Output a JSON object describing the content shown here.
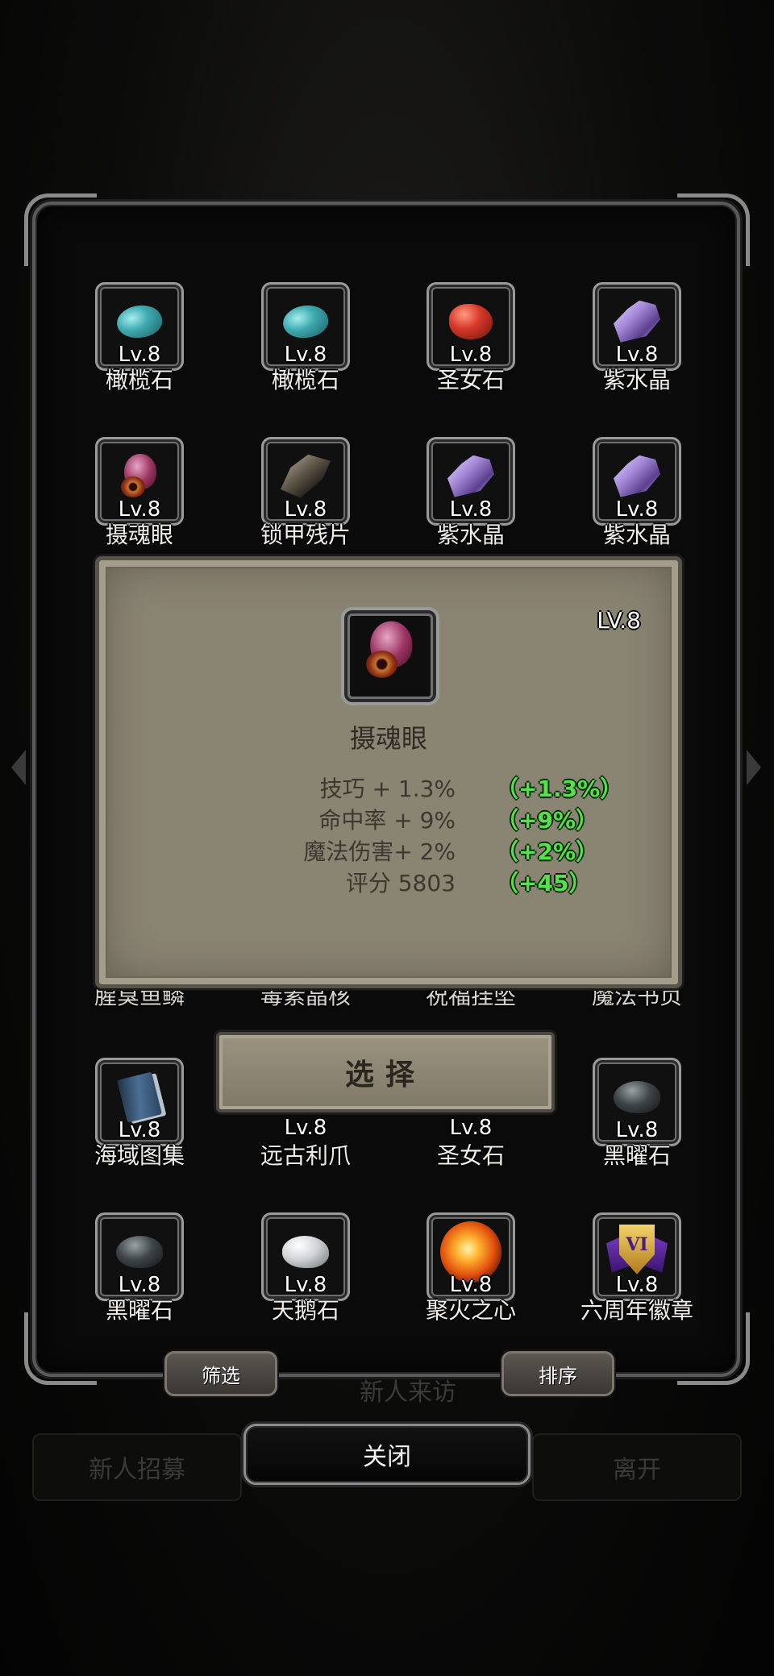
{
  "items": [
    {
      "gem": "olive",
      "level": "Lv.8",
      "name": "橄榄石"
    },
    {
      "gem": "olive",
      "level": "Lv.8",
      "name": "橄榄石"
    },
    {
      "gem": "red",
      "level": "Lv.8",
      "name": "圣女石"
    },
    {
      "gem": "amethyst",
      "level": "Lv.8",
      "name": "紫水晶"
    },
    {
      "gem": "eye",
      "level": "Lv.8",
      "name": "摄魂眼"
    },
    {
      "gem": "armor",
      "level": "Lv.8",
      "name": "锁甲残片"
    },
    {
      "gem": "amethyst",
      "level": "Lv.8",
      "name": "紫水晶"
    },
    {
      "gem": "amethyst",
      "level": "Lv.8",
      "name": "紫水晶"
    },
    {
      "gem": "hidden",
      "level": "",
      "name": "腥臭鱼鳞"
    },
    {
      "gem": "hidden",
      "level": "",
      "name": "毒素晶核"
    },
    {
      "gem": "hidden",
      "level": "",
      "name": "祝福挂坠"
    },
    {
      "gem": "hidden",
      "level": "",
      "name": "魔法书页"
    },
    {
      "gem": "book",
      "level": "Lv.8",
      "name": "海域图集"
    },
    {
      "gem": "hidden",
      "level": "Lv.8",
      "name": "远古利爪"
    },
    {
      "gem": "hidden",
      "level": "Lv.8",
      "name": "圣女石"
    },
    {
      "gem": "obsidian",
      "level": "Lv.8",
      "name": "黑曜石"
    },
    {
      "gem": "obsidian",
      "level": "Lv.8",
      "name": "黑曜石"
    },
    {
      "gem": "swan",
      "level": "Lv.8",
      "name": "天鹅石"
    },
    {
      "gem": "fire",
      "level": "Lv.8",
      "name": "聚火之心"
    },
    {
      "gem": "badge",
      "level": "Lv.8",
      "name": "六周年徽章"
    }
  ],
  "badge_numeral": "VI",
  "detail": {
    "level": "LV.8",
    "icon": "soul-eye-icon",
    "name": "摄魂眼",
    "stats": [
      {
        "label": "技巧 + 1.3%",
        "delta": "（+1.3%）"
      },
      {
        "label": "命中率 + 9%",
        "delta": "（+9%）"
      },
      {
        "label": "魔法伤害+ 2%",
        "delta": "（+2%）"
      },
      {
        "label": "评分 5803",
        "delta": "（+45）"
      }
    ]
  },
  "buttons": {
    "select": "选择",
    "filter": "筛选",
    "sort": "排序",
    "close": "关闭"
  },
  "background": {
    "recruit": "新人招募",
    "leave": "离开",
    "visit": "新人来访"
  },
  "colors": {
    "delta_green": "#56e04b",
    "parchment": "#8a8473",
    "frame_silver": "#9a9a9a"
  }
}
